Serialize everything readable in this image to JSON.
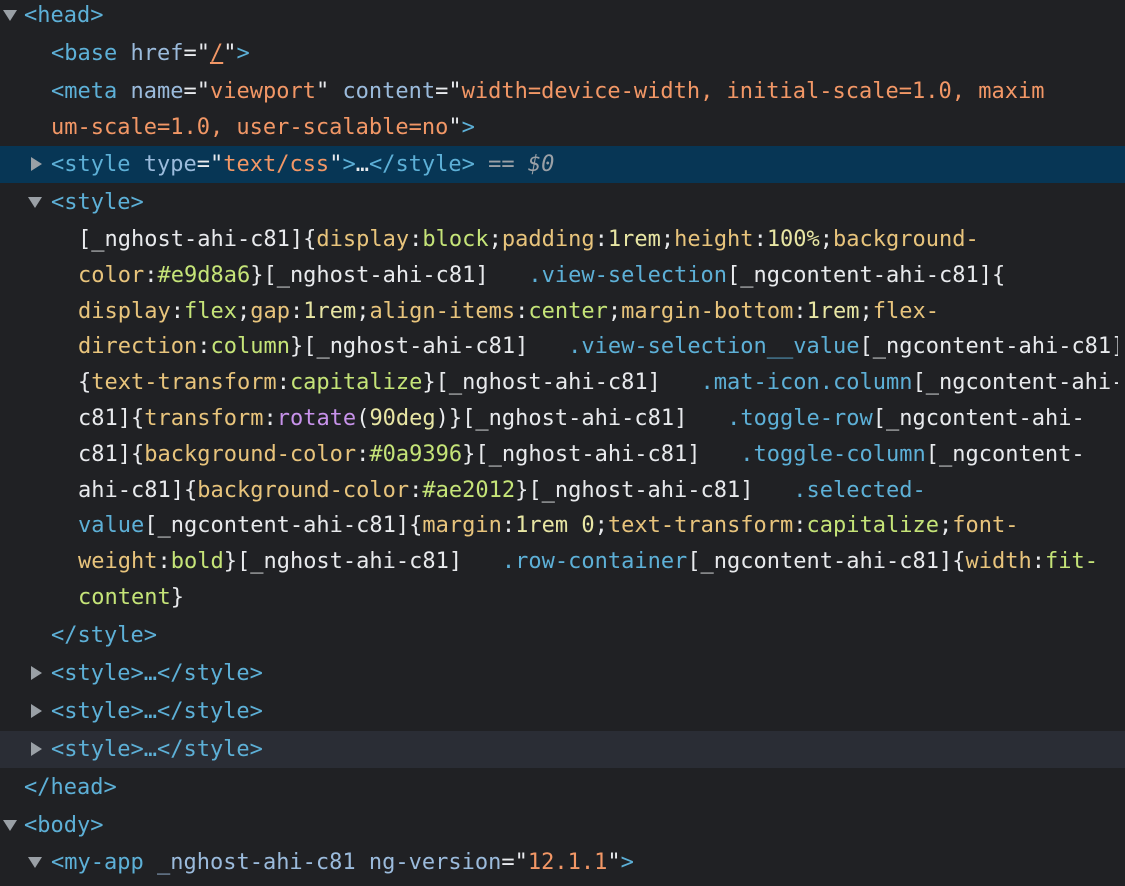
{
  "nodes": {
    "head_open": "<head>",
    "base": {
      "tag": "base",
      "attr": "href",
      "value": "/"
    },
    "meta": {
      "tag": "meta",
      "attr1": "name",
      "val1": "viewport",
      "attr2": "content",
      "val2_line1": "width=device-width, initial-scale=1.0, maxim",
      "val2_line2": "um-scale=1.0, user-scalable=no"
    },
    "style_selected": {
      "tag": "style",
      "attr": "type",
      "value": "text/css",
      "ellipsis": "…",
      "marker": "== $0"
    },
    "style_open": "<style>",
    "style_close": "</style>",
    "collapsed_style": "<style>…</style>",
    "head_close": "</head>",
    "body_open": "<body>",
    "my_app": {
      "tag": "my-app",
      "attr1": "_nghost-ahi-c81",
      "attr2": "ng-version",
      "val2": "12.1.1"
    }
  },
  "css": {
    "selector_host": "[_nghost-ahi-c81]",
    "scope": "[_ngcontent-ahi-c81]",
    "rules": [
      {
        "sel": "",
        "decls": [
          [
            "display",
            "block"
          ],
          [
            "padding",
            "1rem"
          ],
          [
            "height",
            "100%"
          ],
          [
            "background-color",
            "#e9d8a6"
          ]
        ]
      },
      {
        "sel": ".view-selection",
        "decls": [
          [
            "display",
            "flex"
          ],
          [
            "gap",
            "1rem"
          ],
          [
            "align-items",
            "center"
          ],
          [
            "margin-bottom",
            "1rem"
          ],
          [
            "flex-direction",
            "column"
          ]
        ]
      },
      {
        "sel": ".view-selection__value",
        "decls": [
          [
            "text-transform",
            "capitalize"
          ]
        ]
      },
      {
        "sel": ".mat-icon.column",
        "decls": [
          [
            "transform",
            "rotate(90deg)"
          ]
        ]
      },
      {
        "sel": ".toggle-row",
        "decls": [
          [
            "background-color",
            "#0a9396"
          ]
        ]
      },
      {
        "sel": ".toggle-column",
        "decls": [
          [
            "background-color",
            "#ae2012"
          ]
        ]
      },
      {
        "sel": ".selected-value",
        "decls": [
          [
            "margin",
            "1rem 0"
          ],
          [
            "text-transform",
            "capitalize"
          ],
          [
            "font-weight",
            "bold"
          ]
        ]
      },
      {
        "sel": ".row-container",
        "decls": [
          [
            "width",
            "fit-content"
          ]
        ]
      }
    ]
  }
}
